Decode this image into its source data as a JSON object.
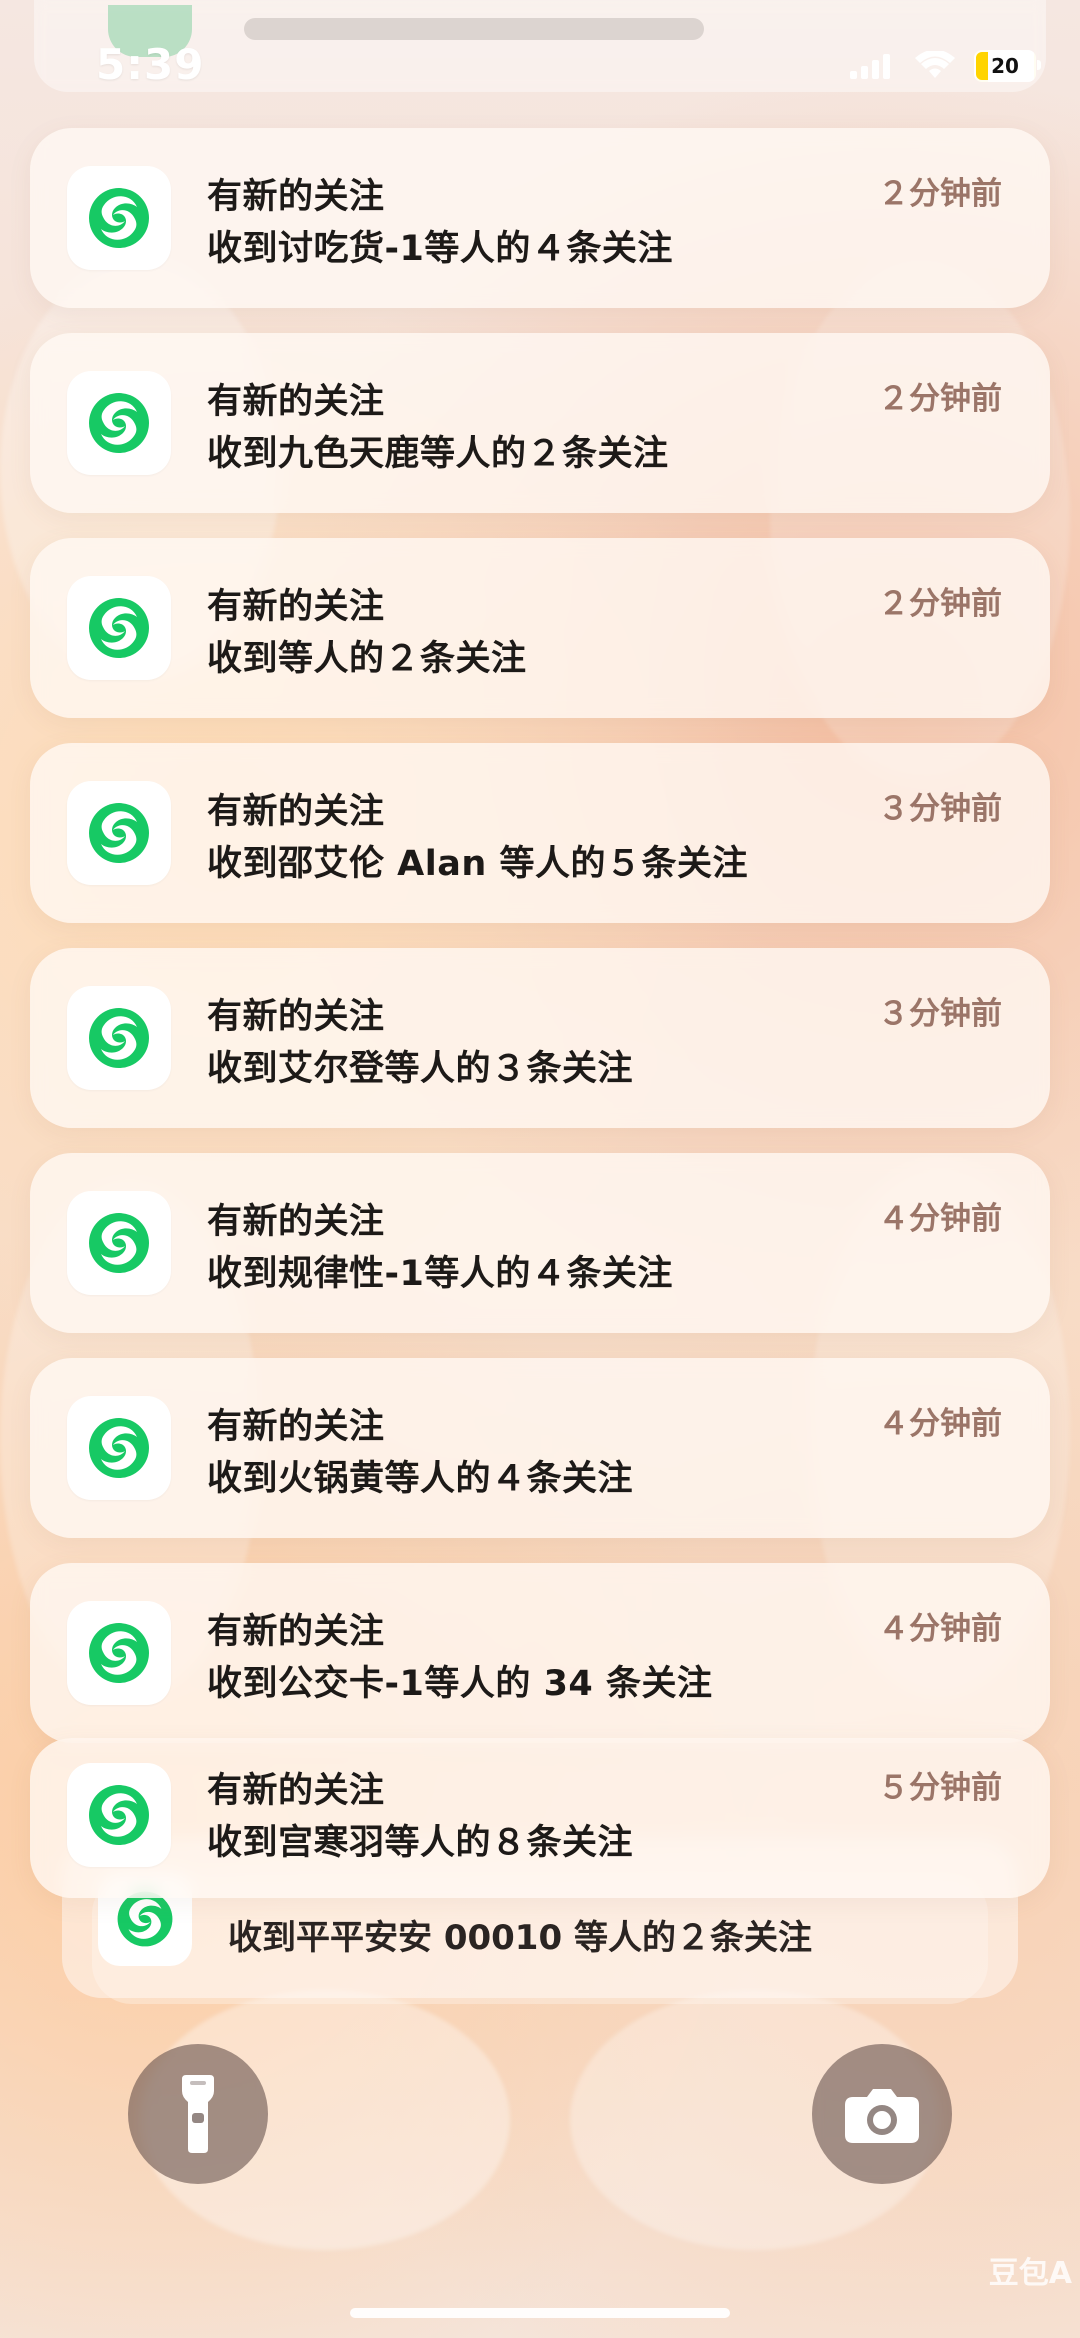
{
  "status_bar": {
    "time": "5:39",
    "battery": "20",
    "icons": {
      "signal": "signal-icon",
      "wifi": "wifi-icon",
      "battery": "battery-icon"
    }
  },
  "colors": {
    "notification_text": "#1d1a18",
    "notification_time": "#9b7568",
    "app_green": "#17c964",
    "status_text": "#ffffff"
  },
  "notifications": [
    {
      "title": "有新的关注",
      "body": "收到讨吃货-1等人的４条关注",
      "time": "２分钟前",
      "icon": "app-icon"
    },
    {
      "title": "有新的关注",
      "body": "收到九色天鹿等人的２条关注",
      "time": "２分钟前",
      "icon": "app-icon"
    },
    {
      "title": "有新的关注",
      "body": "收到等人的２条关注",
      "time": "２分钟前",
      "icon": "app-icon"
    },
    {
      "title": "有新的关注",
      "body": "收到邵艾伦 Alan 等人的５条关注",
      "time": "３分钟前",
      "icon": "app-icon"
    },
    {
      "title": "有新的关注",
      "body": "收到艾尔登等人的３条关注",
      "time": "３分钟前",
      "icon": "app-icon"
    },
    {
      "title": "有新的关注",
      "body": "收到规律性-1等人的４条关注",
      "time": "４分钟前",
      "icon": "app-icon"
    },
    {
      "title": "有新的关注",
      "body": "收到火锅黄等人的４条关注",
      "time": "４分钟前",
      "icon": "app-icon"
    },
    {
      "title": "有新的关注",
      "body": "收到公交卡-1等人的 34 条关注",
      "time": "４分钟前",
      "icon": "app-icon"
    },
    {
      "title": "有新的关注",
      "body": "收到宫寒羽等人的８条关注",
      "time": "５分钟前",
      "icon": "app-icon"
    }
  ],
  "stacked_notification": {
    "body": "收到平平安安 00010 等人的２条关注",
    "icon": "app-icon"
  },
  "bottom_controls": {
    "flashlight": "flashlight-icon",
    "camera": "camera-icon"
  },
  "watermark": "豆包A"
}
